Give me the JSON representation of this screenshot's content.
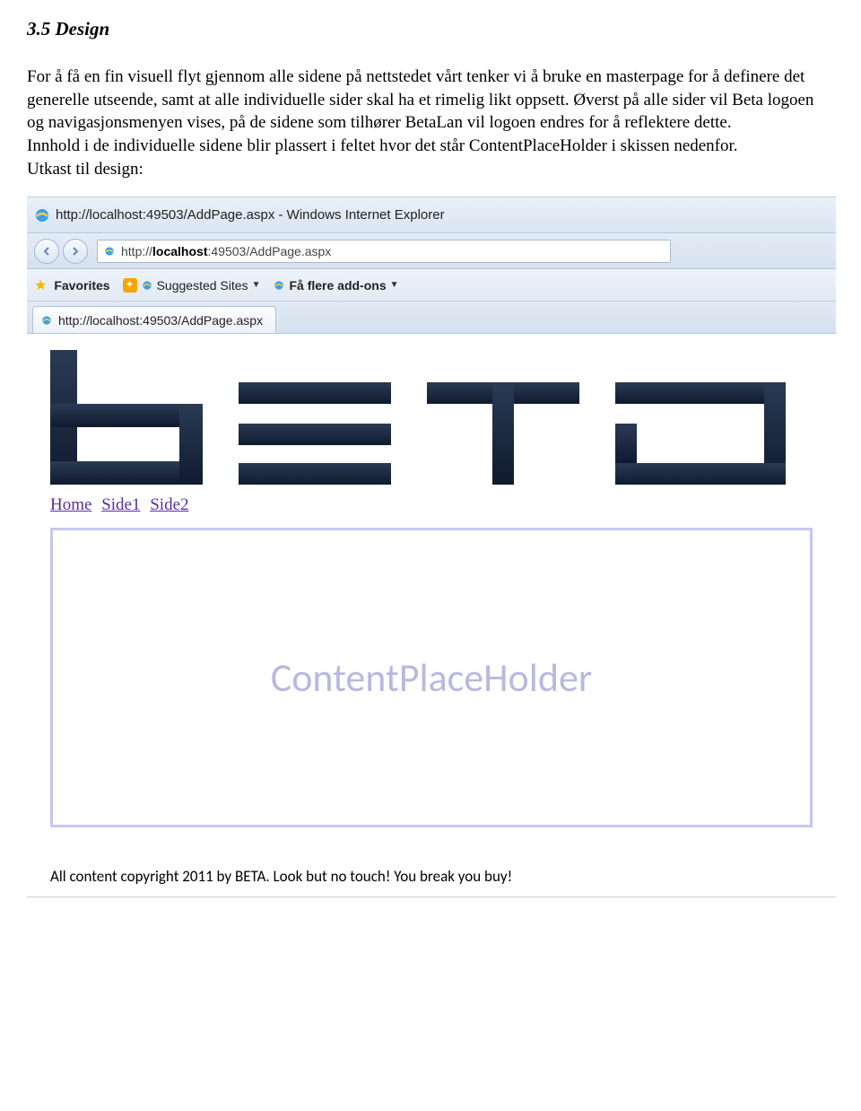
{
  "doc": {
    "heading": "3.5 Design",
    "p1": "For å få en fin visuell flyt gjennom alle sidene på nettstedet vårt tenker vi å bruke en masterpage for å definere det generelle utseende, samt at alle individuelle sider skal ha et rimelig likt oppsett. Øverst på alle sider vil Beta logoen og navigasjonsmenyen vises, på de sidene som tilhører BetaLan vil logoen endres for å reflektere dette.",
    "p2": "Innhold i de individuelle sidene blir plassert i feltet hvor det står ContentPlaceHolder i skissen nedenfor.",
    "subtitle": "Utkast til design:"
  },
  "ie": {
    "window_title": "http://localhost:49503/AddPage.aspx - Windows Internet Explorer",
    "address_prefix": "http://",
    "address_bold": "localhost",
    "address_suffix": ":49503/AddPage.aspx",
    "favorites_label": "Favorites",
    "suggested_sites": "Suggested Sites",
    "addons_label": "Få flere add-ons",
    "tab_label": "http://localhost:49503/AddPage.aspx"
  },
  "page": {
    "nav": [
      "Home",
      "Side1",
      "Side2"
    ],
    "placeholder_text": "ContentPlaceHolder",
    "footer": "All content copyright 2011 by BETA. Look but no touch! You break you buy!"
  }
}
